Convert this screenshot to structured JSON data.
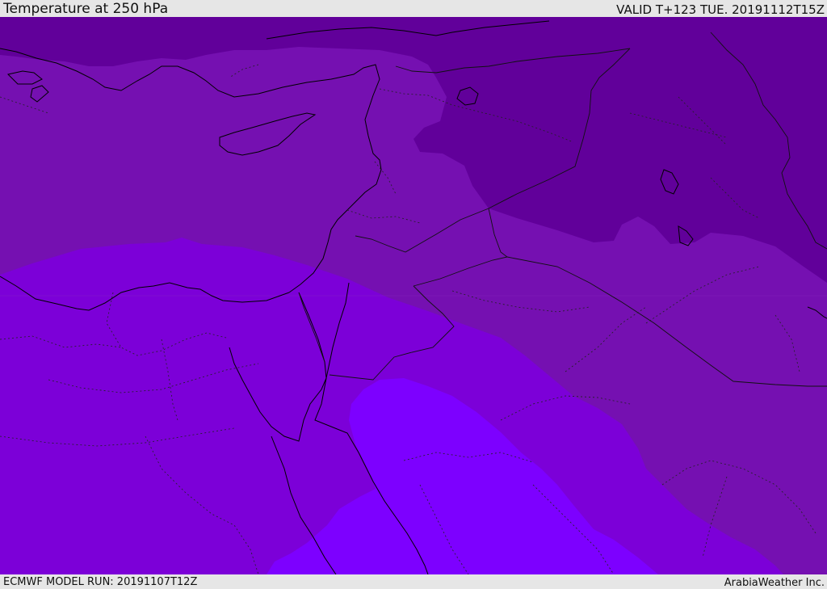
{
  "header": {
    "title": "Temperature at 250 hPa",
    "valid": "VALID T+123 TUE. 20191112T15Z"
  },
  "footer": {
    "model_run": "ECMWF MODEL RUN: 20191107T12Z",
    "credit": "ArabiaWeather Inc."
  },
  "colors": {
    "coldest": "#61009a",
    "cold": "#7510b1",
    "mid": "#7c00d8",
    "warm": "#7d00ff",
    "background": "#e6e6e6"
  }
}
